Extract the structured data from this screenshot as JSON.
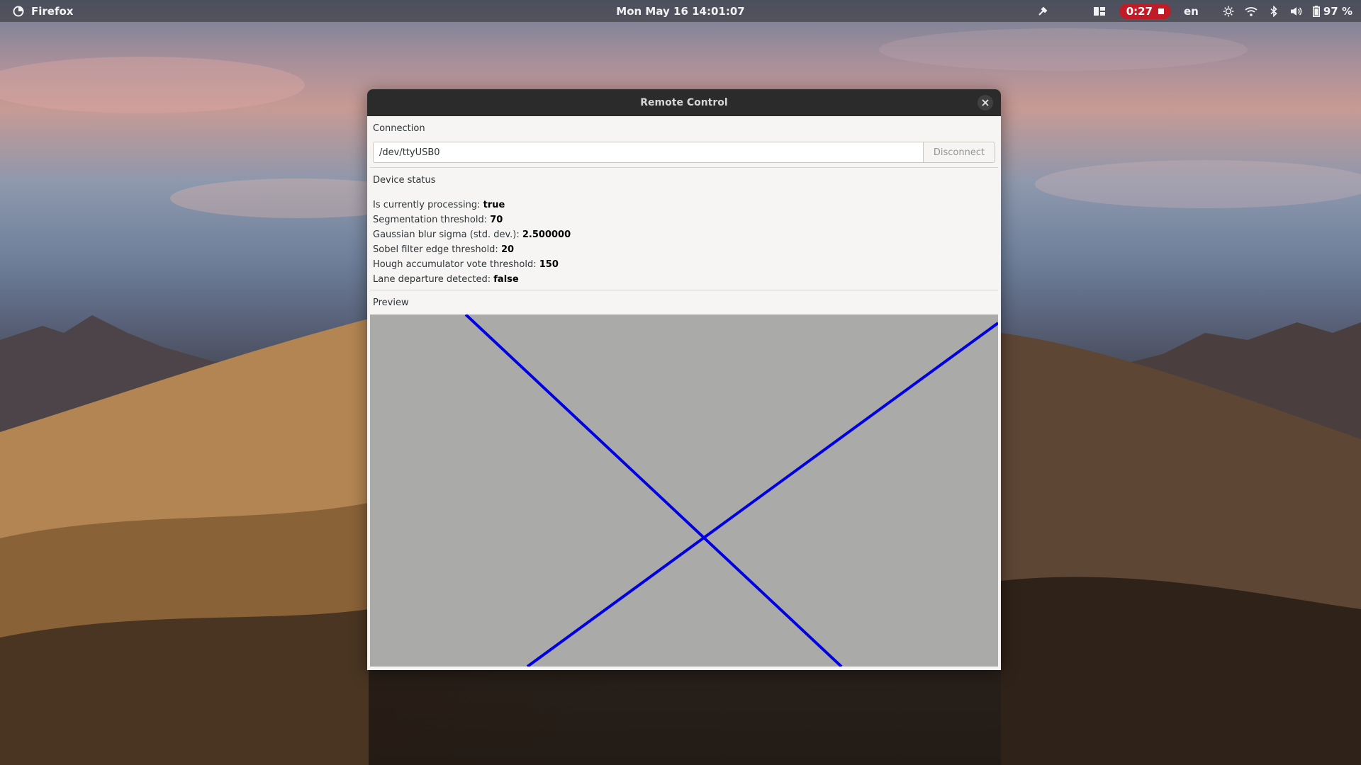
{
  "topbar": {
    "app_name": "Firefox",
    "clock": "Mon May 16  14:01:07",
    "recording_time": "0:27",
    "language": "en",
    "battery": "97 %",
    "icons": [
      "firefox-icon",
      "color-picker-icon",
      "keyboard-layout-icon",
      "stop-icon",
      "brightness-icon",
      "wifi-icon",
      "bluetooth-icon",
      "volume-icon",
      "battery-icon"
    ]
  },
  "window": {
    "title": "Remote Control",
    "connection": {
      "label": "Connection",
      "port_value": "/dev/ttyUSB0",
      "disconnect_label": "Disconnect"
    },
    "device_status": {
      "label": "Device status",
      "items": [
        {
          "label": "Is currently processing:",
          "value": "true"
        },
        {
          "label": "Segmentation threshold:",
          "value": "70"
        },
        {
          "label": "Gaussian blur sigma (std. dev.):",
          "value": "2.500000"
        },
        {
          "label": "Sobel filter edge threshold:",
          "value": "20"
        },
        {
          "label": "Hough accumulator vote threshold:",
          "value": "150"
        },
        {
          "label": "Lane departure detected:",
          "value": "false"
        }
      ]
    },
    "preview": {
      "label": "Preview",
      "background_color": "#aaaaa8",
      "line_color": "#0000e0"
    }
  }
}
